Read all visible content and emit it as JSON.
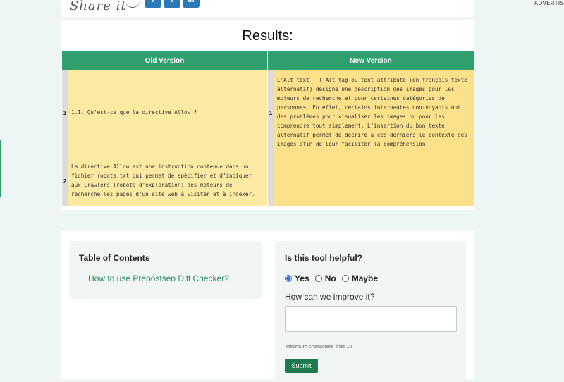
{
  "share": {
    "label": "Share it",
    "buttons": [
      {
        "icon": "facebook-icon",
        "glyph": "f"
      },
      {
        "icon": "twitter-icon",
        "glyph": "t"
      },
      {
        "icon": "linkedin-icon",
        "glyph": "in"
      }
    ]
  },
  "advert_label": "ADVERTIS",
  "results": {
    "title": "Results:",
    "headers": {
      "old": "Old Version",
      "new": "New Version"
    },
    "rows": [
      {
        "old_line": "1",
        "old_text": "1.1. Qu’est-ce que la directive Allow ?",
        "new_line": "1",
        "new_text": "L’Alt text , l’Alt tag ou text attribute (en français texte alternatif) désigne une description des images pour les moteurs de recherche et pour certaines catégories de personnes. En effet, certains internautes non-voyants ont des problèmes pour visualiser les images ou pour les comprendre tout simplement. L’insertion du bon texte alternatif permet de décrire à ces derniers le contexte des images afin de leur faciliter la compréhension."
      },
      {
        "old_line": "2",
        "old_text": "La directive Allow est une instruction contenue dans un fichier robots.txt qui permet de spécifier et d’indiquer aux Crawlers (robots d’exploration) des moteurs de recherche les pages d’un site web à visiter et à indexer.",
        "new_line": "",
        "new_text": ""
      }
    ]
  },
  "toc": {
    "title": "Table of Contents",
    "link": "How to use Prepostseo Diff Checker?"
  },
  "feedback": {
    "title": "Is this tool helpful?",
    "options": [
      {
        "label": "Yes",
        "checked": true
      },
      {
        "label": "No",
        "checked": false
      },
      {
        "label": "Maybe",
        "checked": false
      }
    ],
    "improve_label": "How can we improve it?",
    "improve_value": "",
    "min_hint": "Minimum characters limit 10",
    "submit_label": "Submit"
  },
  "colors": {
    "header_green": "#2f9f6e",
    "old_cell": "#fdeaa2",
    "new_cell": "#fde18a",
    "social_blue": "#2c78b8",
    "submit_green": "#1e7a4e",
    "link_green": "#2a8a5e"
  }
}
